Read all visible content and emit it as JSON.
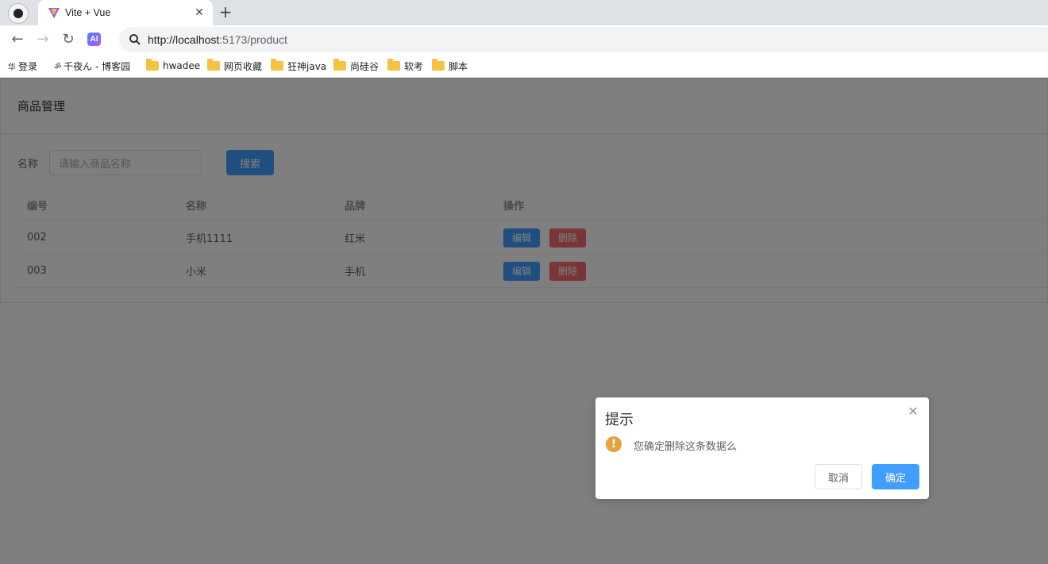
{
  "browser": {
    "tab_title": "Vite + Vue",
    "tab_close_icon": "close-icon",
    "new_tab_label": "+",
    "url_host": "http://localhost",
    "url_rest": ":5173/product",
    "ai_label": "AI",
    "bookmarks": [
      {
        "prefix": "华",
        "label": "登录",
        "icon": "site-icon"
      },
      {
        "prefix": "ॐ",
        "label": "千夜ん - 博客园",
        "icon": "site-icon"
      },
      {
        "label": "hwadee",
        "icon": "folder-icon"
      },
      {
        "label": "网页收藏",
        "icon": "folder-icon"
      },
      {
        "label": "狂神java",
        "icon": "folder-icon"
      },
      {
        "label": "尚硅谷",
        "icon": "folder-icon"
      },
      {
        "label": "软考",
        "icon": "folder-icon"
      },
      {
        "label": "脚本",
        "icon": "folder-icon"
      }
    ]
  },
  "page": {
    "card_title": "商品管理",
    "search": {
      "label": "名称",
      "placeholder": "请输入商品名称",
      "button": "搜索"
    },
    "table": {
      "columns": [
        "编号",
        "名称",
        "品牌",
        "操作"
      ],
      "rows": [
        {
          "id": "002",
          "name": "手机1111",
          "brand": "红米"
        },
        {
          "id": "003",
          "name": "小米",
          "brand": "手机"
        }
      ],
      "edit_label": "编辑",
      "delete_label": "删除"
    }
  },
  "dialog": {
    "title": "提示",
    "message": "您确定删除这条数据么",
    "cancel": "取消",
    "confirm": "确定",
    "warning_glyph": "!",
    "close_glyph": "✕"
  },
  "colors": {
    "primary": "#409eff",
    "danger": "#f56c6c",
    "warning": "#e6a23c"
  }
}
